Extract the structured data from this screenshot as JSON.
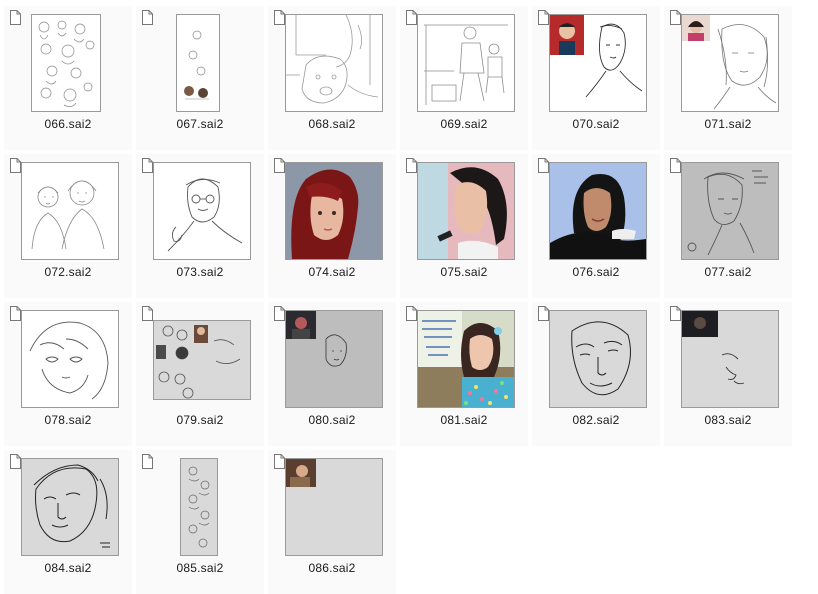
{
  "files": [
    {
      "name": "066.sai2",
      "thumb": "sketch-sheet",
      "icon": "file-icon"
    },
    {
      "name": "067.sai2",
      "thumb": "tall-sketch",
      "icon": "file-icon"
    },
    {
      "name": "068.sai2",
      "thumb": "dog-sketch",
      "icon": "file-icon"
    },
    {
      "name": "069.sai2",
      "thumb": "figures-sketch",
      "icon": "file-icon"
    },
    {
      "name": "070.sai2",
      "thumb": "portrait-with-reference",
      "icon": "file-icon"
    },
    {
      "name": "071.sai2",
      "thumb": "portrait-with-reference",
      "icon": "file-icon"
    },
    {
      "name": "072.sai2",
      "thumb": "couple-sketch",
      "icon": "file-icon"
    },
    {
      "name": "073.sai2",
      "thumb": "glasses-portrait",
      "icon": "file-icon"
    },
    {
      "name": "074.sai2",
      "thumb": "red-hair-painting",
      "icon": "file-icon"
    },
    {
      "name": "075.sai2",
      "thumb": "singer-painting",
      "icon": "file-icon"
    },
    {
      "name": "076.sai2",
      "thumb": "blue-bg-painting",
      "icon": "file-icon"
    },
    {
      "name": "077.sai2",
      "thumb": "gray-portrait",
      "icon": "file-icon"
    },
    {
      "name": "078.sai2",
      "thumb": "anime-sketch",
      "icon": "file-icon"
    },
    {
      "name": "079.sai2",
      "thumb": "study-sheet",
      "icon": "file-icon"
    },
    {
      "name": "080.sai2",
      "thumb": "gray-with-reference",
      "icon": "file-icon"
    },
    {
      "name": "081.sai2",
      "thumb": "colorful-painting",
      "icon": "file-icon"
    },
    {
      "name": "082.sai2",
      "thumb": "face-sketch-gray",
      "icon": "file-icon"
    },
    {
      "name": "083.sai2",
      "thumb": "gray-with-reference",
      "icon": "file-icon"
    },
    {
      "name": "084.sai2",
      "thumb": "face-sketch-gray",
      "icon": "file-icon"
    },
    {
      "name": "085.sai2",
      "thumb": "tall-gray-sketch",
      "icon": "file-icon"
    },
    {
      "name": "086.sai2",
      "thumb": "gray-with-reference",
      "icon": "file-icon"
    }
  ],
  "colors": {
    "tile_bg": "#fafafa",
    "thumb_border": "#9a9a9a",
    "canvas_gray": "#bdbdbd",
    "canvas_light_gray": "#d9d9d9"
  }
}
